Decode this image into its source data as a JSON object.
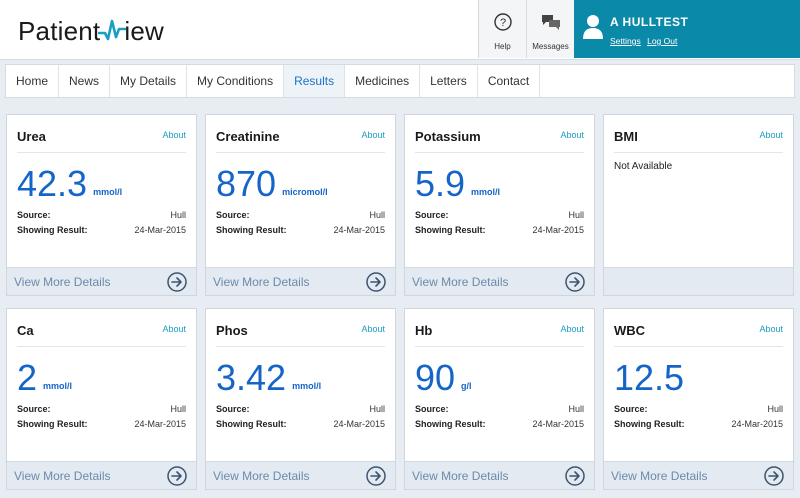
{
  "header": {
    "logo_left": "Patient",
    "logo_right": "iew",
    "help_label": "Help",
    "messages_label": "Messages",
    "user_name": "A HULLTEST",
    "settings_label": "Settings",
    "logout_label": "Log Out"
  },
  "nav": [
    "Home",
    "News",
    "My Details",
    "My Conditions",
    "Results",
    "Medicines",
    "Letters",
    "Contact"
  ],
  "nav_active": "Results",
  "labels": {
    "about": "About",
    "source": "Source:",
    "showing": "Showing Result:",
    "view_more": "View More Details"
  },
  "cards": [
    {
      "title": "Urea",
      "value": "42.3",
      "unit": "mmol/l",
      "source": "Hull",
      "date": "24-Mar-2015"
    },
    {
      "title": "Creatinine",
      "value": "870",
      "unit": "micromol/l",
      "source": "Hull",
      "date": "24-Mar-2015"
    },
    {
      "title": "Potassium",
      "value": "5.9",
      "unit": "mmol/l",
      "source": "Hull",
      "date": "24-Mar-2015"
    },
    {
      "title": "BMI",
      "na": "Not Available"
    },
    {
      "title": "Ca",
      "value": "2",
      "unit": "mmol/l",
      "source": "Hull",
      "date": "24-Mar-2015"
    },
    {
      "title": "Phos",
      "value": "3.42",
      "unit": "mmol/l",
      "source": "Hull",
      "date": "24-Mar-2015"
    },
    {
      "title": "Hb",
      "value": "90",
      "unit": "g/l",
      "source": "Hull",
      "date": "24-Mar-2015"
    },
    {
      "title": "WBC",
      "value": "12.5",
      "unit": "",
      "source": "Hull",
      "date": "24-Mar-2015"
    }
  ],
  "colors": {
    "accent": "#0a8aa8",
    "value_blue": "#1565c8",
    "about_link": "#1a9ec2"
  }
}
